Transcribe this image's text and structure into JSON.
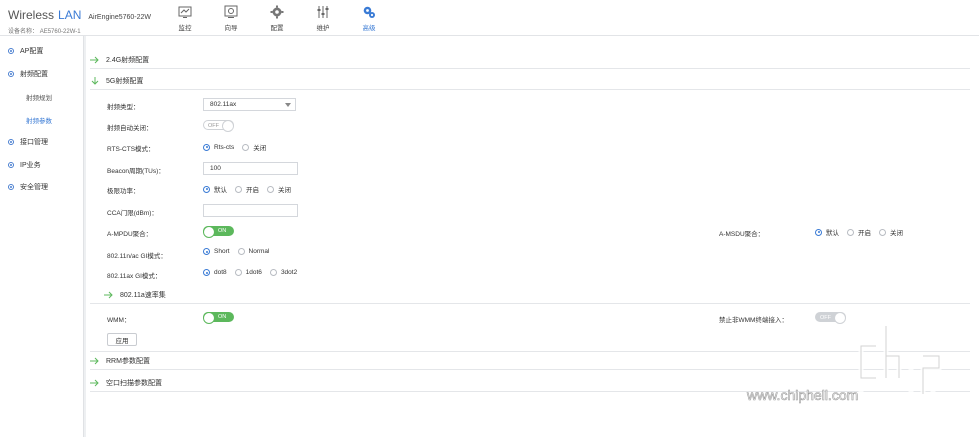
{
  "brand": {
    "wireless": "Wireless",
    "lan": "LAN",
    "model": "AirEngine5760-22W",
    "device_label": "设备名称：",
    "device_name": "AE5760-22W-1"
  },
  "nav": [
    {
      "label": "监控",
      "icon": "monitor-icon"
    },
    {
      "label": "向导",
      "icon": "wizard-icon"
    },
    {
      "label": "配置",
      "icon": "gear-icon"
    },
    {
      "label": "维护",
      "icon": "sliders-icon"
    },
    {
      "label": "高级",
      "icon": "advanced-gear-icon",
      "active": true
    }
  ],
  "sidebar": {
    "items": [
      {
        "label": "AP配置"
      },
      {
        "label": "射频配置"
      },
      {
        "label": "射频规划",
        "sub": true
      },
      {
        "label": "射频参数",
        "sub": true,
        "active": true
      },
      {
        "label": "接口管理"
      },
      {
        "label": "IP业务"
      },
      {
        "label": "安全管理"
      }
    ]
  },
  "sections": {
    "s24g": "2.4G射频配置",
    "s5g": "5G射频配置",
    "rate": "802.11a速率集",
    "rrm": "RRM参数配置",
    "scan": "空口扫描参数配置"
  },
  "form": {
    "radio_type_label": "射频类型：",
    "radio_type_value": "802.11ax",
    "radio_autoshut_label": "射频自动关闭：",
    "radio_autoshut_value": "OFF",
    "rts_label": "RTS-CTS模式：",
    "rts_options": [
      "Rts-cts",
      "关闭"
    ],
    "beacon_label": "Beacon周期(TUs)：",
    "beacon_value": "100",
    "power_label": "极限功率：",
    "power_options": [
      "默认",
      "开启",
      "关闭"
    ],
    "cca_label": "CCA门限(dBm)：",
    "cca_value": "",
    "ampdu_label": "A-MPDU聚合：",
    "ampdu_value": "ON",
    "amsdu_label": "A-MSDU聚合：",
    "amsdu_options": [
      "默认",
      "开启",
      "关闭"
    ],
    "gi_n_label": "802.11n/ac GI模式：",
    "gi_n_options": [
      "Short",
      "Normal"
    ],
    "gi_ax_label": "802.11ax GI模式：",
    "gi_ax_options": [
      "dot8",
      "1dot6",
      "3dot2"
    ],
    "wmm_label": "WMM：",
    "wmm_value": "ON",
    "nonwmm_label": "禁止非WMM终端接入：",
    "nonwmm_value": "OFF",
    "apply_label": "应用"
  },
  "watermark": {
    "text": "www.chiphell.com",
    "logo": "chip hell"
  },
  "colors": {
    "accent": "#3a7bd5",
    "toggle_on": "#5cb85c",
    "arrow": "#5cb85c"
  }
}
